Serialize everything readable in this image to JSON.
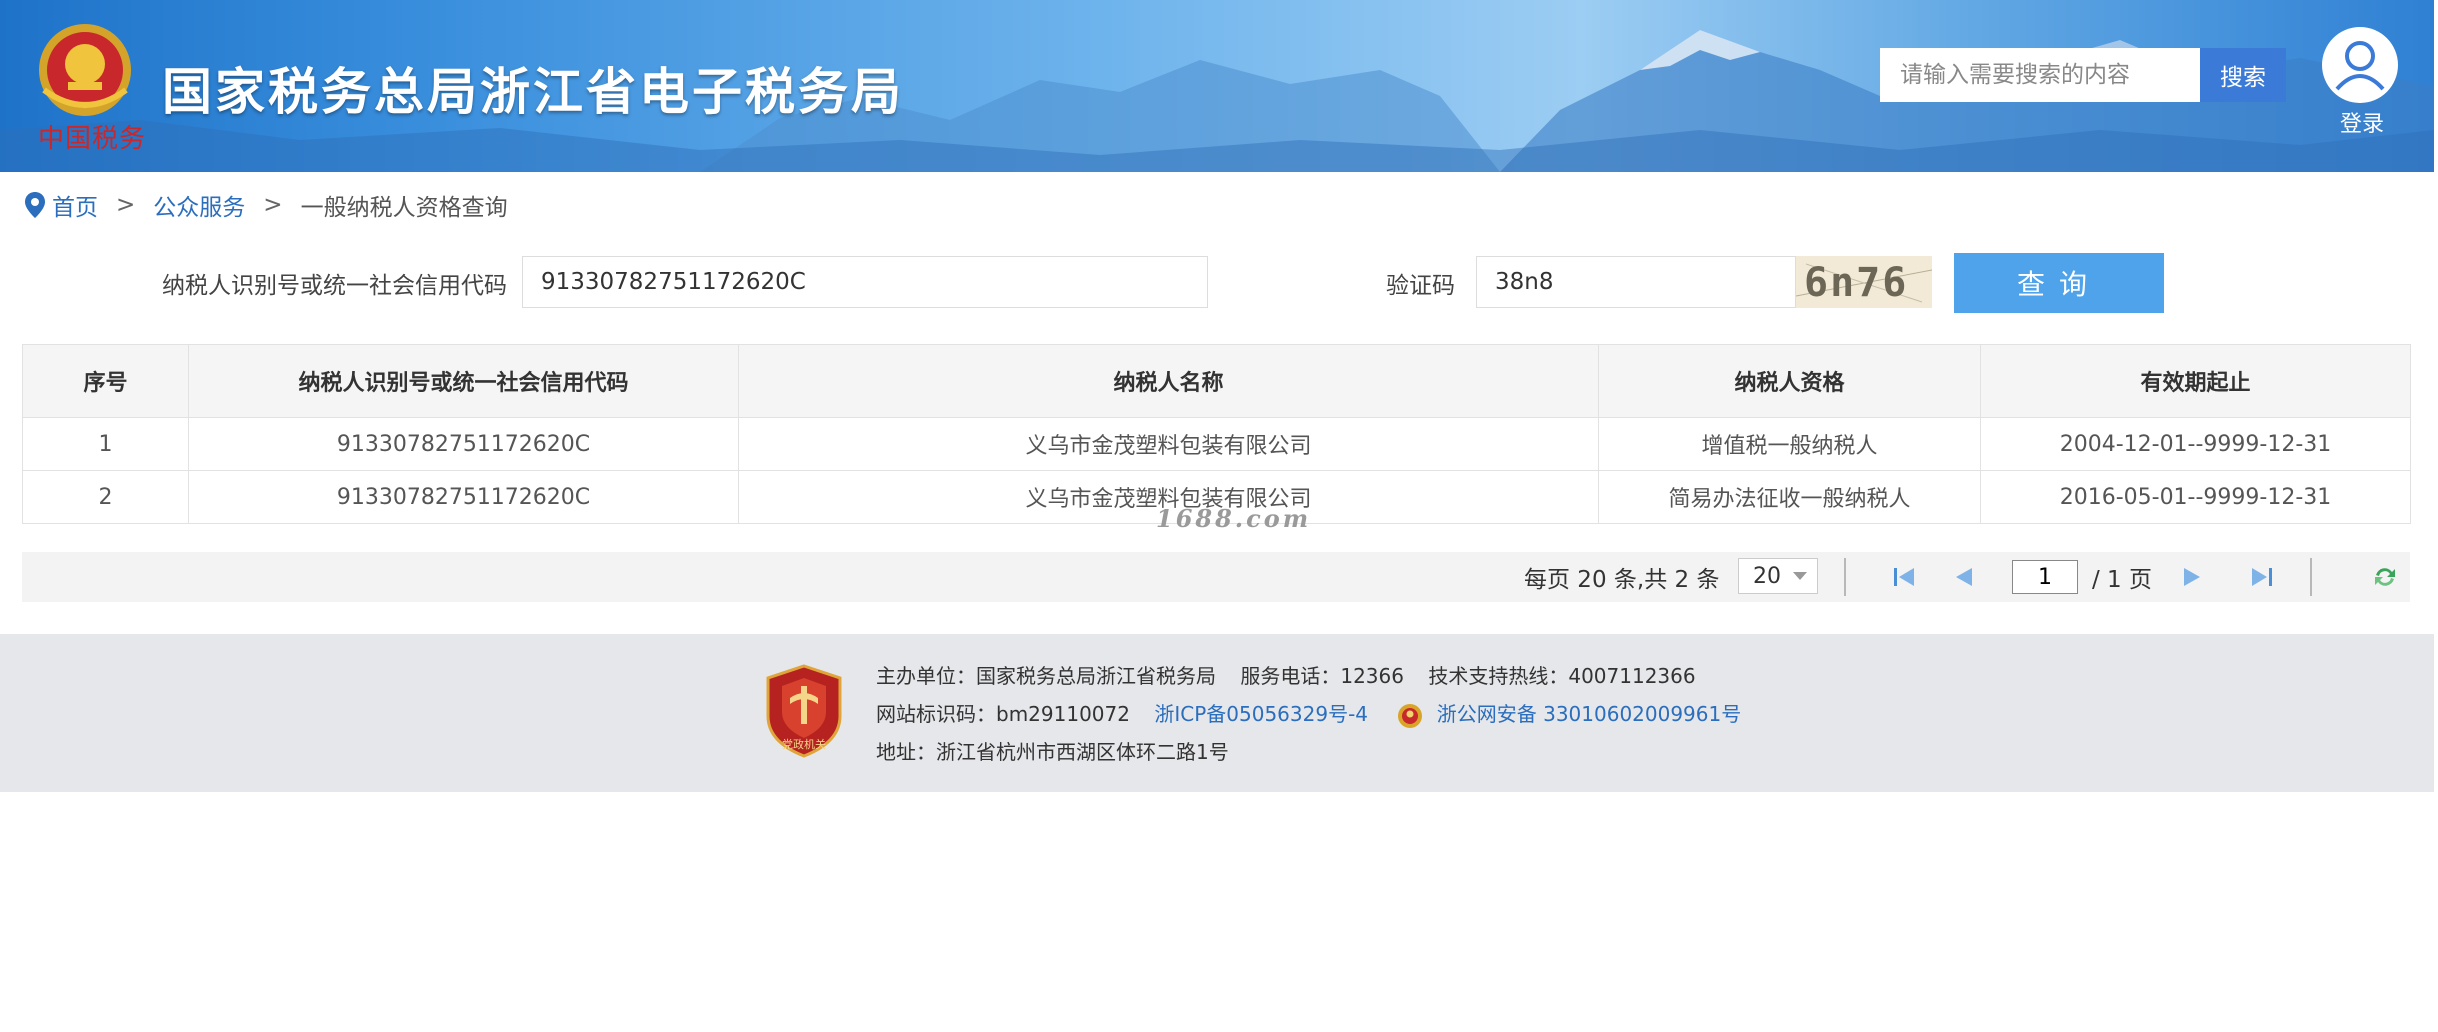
{
  "header": {
    "emblem_script": "中国税务",
    "site_title": "国家税务总局浙江省电子税务局",
    "search_placeholder": "请输入需要搜索的内容",
    "search_button": "搜索",
    "login_label": "登录"
  },
  "breadcrumb": {
    "home": "首页",
    "sep": ">",
    "public_service": "公众服务",
    "current": "一般纳税人资格查询"
  },
  "form": {
    "tax_id_label": "纳税人识别号或统一社会信用代码",
    "tax_id_value": "91330782751172620C",
    "captcha_label": "验证码",
    "captcha_value": "38n8",
    "captcha_image_text": "6n76",
    "query_button": "查询"
  },
  "table": {
    "headers": [
      "序号",
      "纳税人识别号或统一社会信用代码",
      "纳税人名称",
      "纳税人资格",
      "有效期起止"
    ],
    "rows": [
      [
        "1",
        "91330782751172620C",
        "义乌市金茂塑料包装有限公司",
        "增值税一般纳税人",
        "2004-12-01--9999-12-31"
      ],
      [
        "2",
        "91330782751172620C",
        "义乌市金茂塑料包装有限公司",
        "简易办法征收一般纳税人",
        "2016-05-01--9999-12-31"
      ]
    ]
  },
  "watermark": "1688.com",
  "pager": {
    "summary": "每页 20 条,共 2 条",
    "page_size": "20",
    "current_page": "1",
    "total_pages": "/ 1 页"
  },
  "footer": {
    "sponsor": "主办单位：国家税务总局浙江省税务局",
    "phone": "服务电话：12366",
    "support": "技术支持热线：4007112366",
    "site_code": "网站标识码：bm29110072",
    "icp": "浙ICP备05056329号-4",
    "police": "浙公网安备 33010602009961号",
    "address": "地址：浙江省杭州市西湖区体环二路1号",
    "badge_text": "党政机关"
  },
  "colors": {
    "accent": "#2a6ebd",
    "query_button": "#4ea3ea",
    "search_button": "#3b7ad6",
    "emblem_red": "#c8282b"
  }
}
